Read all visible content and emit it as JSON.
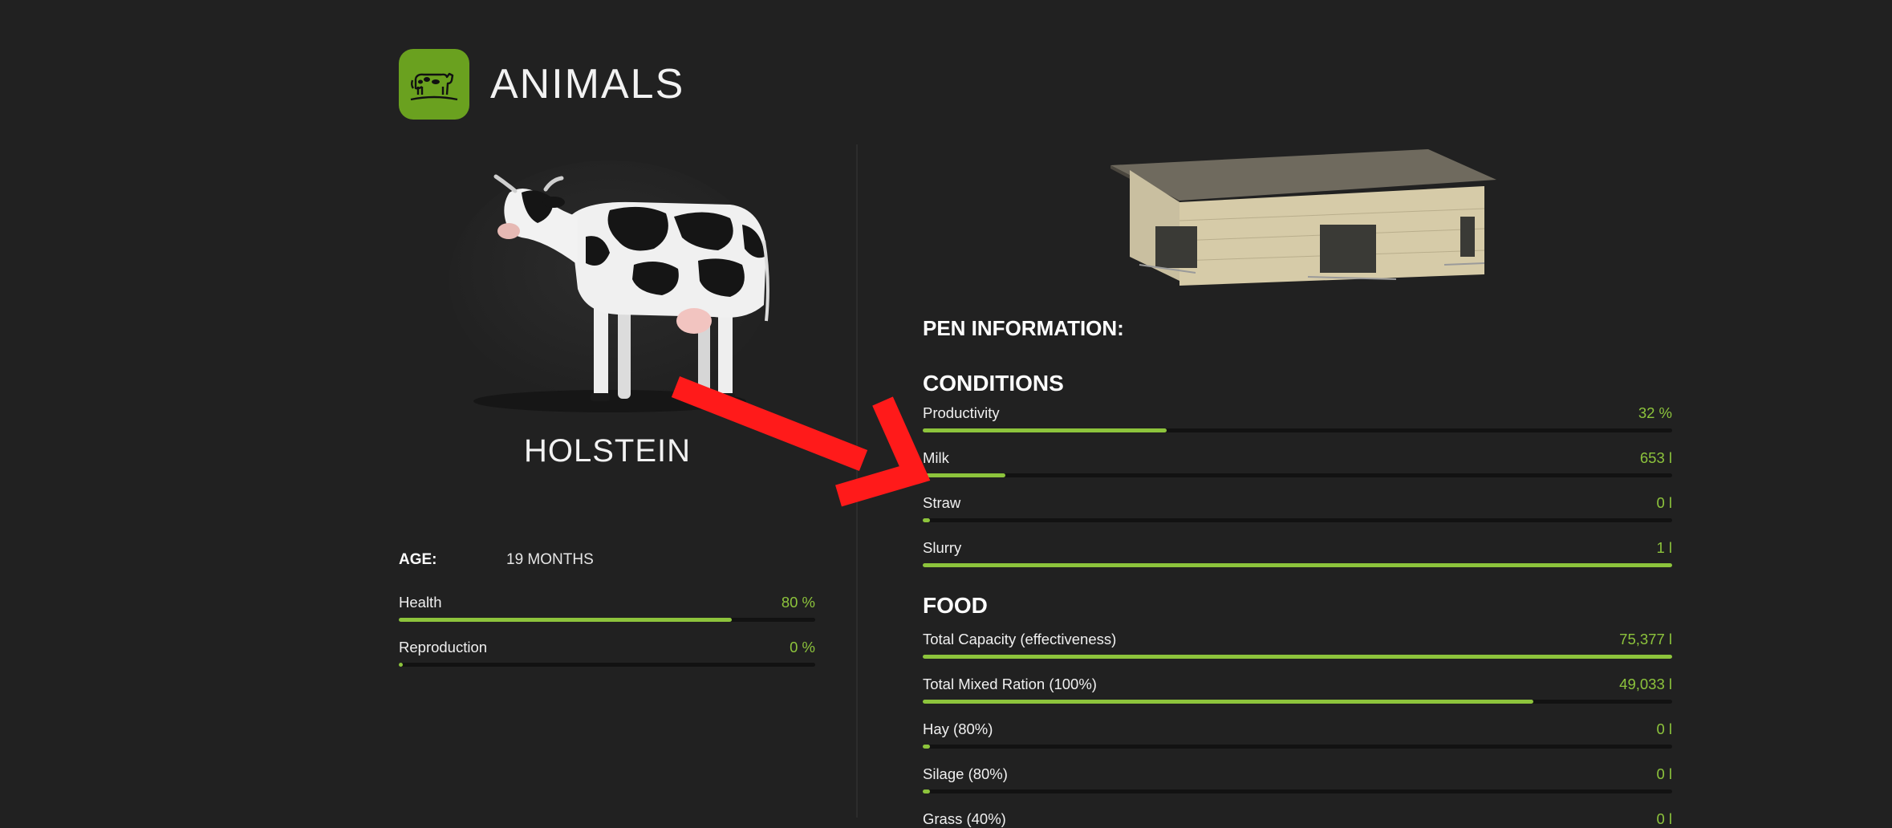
{
  "header": {
    "title": "ANIMALS",
    "icon": "cow-icon",
    "accent": "#6aa11f"
  },
  "animal": {
    "name": "HOLSTEIN",
    "age_label": "AGE:",
    "age_value": "19 MONTHS",
    "stats": [
      {
        "label": "Health",
        "value": "80 %",
        "level": 0.8
      },
      {
        "label": "Reproduction",
        "value": "0 %",
        "level": 0.01
      }
    ]
  },
  "pen": {
    "title": "PEN INFORMATION:",
    "conditions_title": "CONDITIONS",
    "conditions": [
      {
        "label": "Productivity",
        "value": "32 %",
        "level": 0.325
      },
      {
        "label": "Milk",
        "value": "653 l",
        "level": 0.11
      },
      {
        "label": "Straw",
        "value": "0 l",
        "level": 0.01
      },
      {
        "label": "Slurry",
        "value": "1 l",
        "level": 1.0
      }
    ],
    "food_title": "FOOD",
    "food": [
      {
        "label": "Total Capacity (effectiveness)",
        "value": "75,377 l",
        "level": 1.0
      },
      {
        "label": "Total Mixed Ration (100%)",
        "value": "49,033 l",
        "level": 0.815
      },
      {
        "label": "Hay (80%)",
        "value": "0 l",
        "level": 0.01
      },
      {
        "label": "Silage (80%)",
        "value": "0 l",
        "level": 0.01
      },
      {
        "label": "Grass (40%)",
        "value": "0 l",
        "level": 0.01
      }
    ]
  },
  "colors": {
    "background": "#212121",
    "bar_fill": "#8dc43c",
    "bar_track": "#121212",
    "arrow": "#ff1a1a"
  }
}
